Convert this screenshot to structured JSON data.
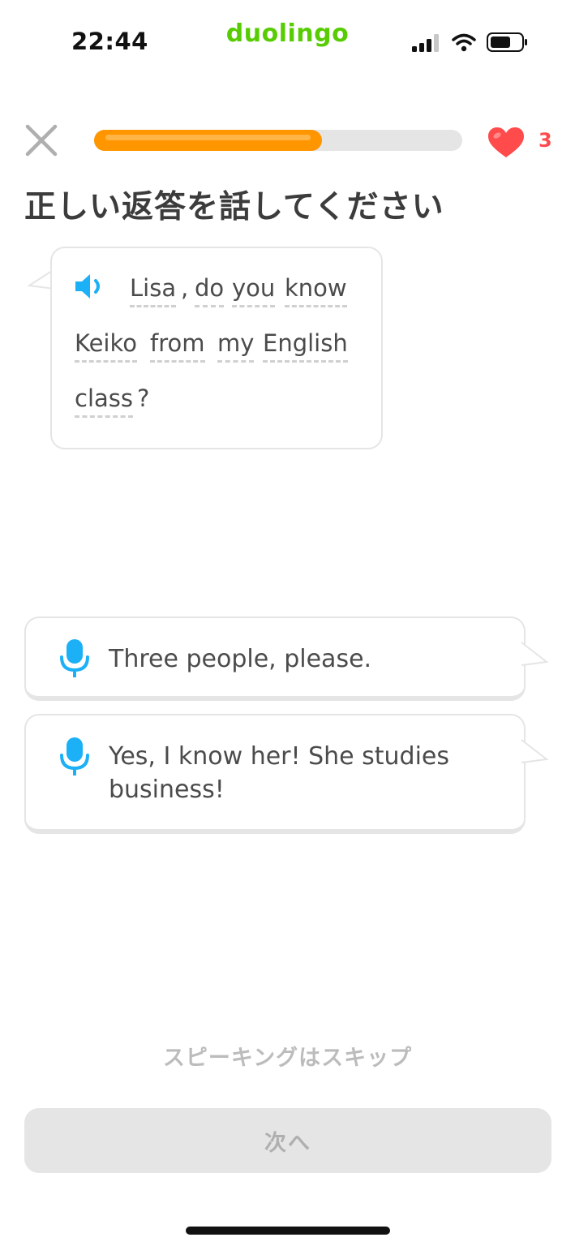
{
  "status_bar": {
    "time": "22:44",
    "brand": "duolingo"
  },
  "lesson": {
    "progress": 0.62,
    "hearts": "3",
    "instruction": "正しい返答を話してください"
  },
  "prompt": {
    "words": [
      "Lisa",
      ",",
      "do",
      "you",
      "know",
      "Keiko",
      "from",
      "my",
      "English",
      "class",
      "?"
    ]
  },
  "options": [
    {
      "lines": [
        "Three people, please."
      ]
    },
    {
      "lines": [
        "Yes, I know her! She studies",
        "business!"
      ]
    }
  ],
  "footer": {
    "skip_label": "スピーキングはスキップ",
    "next_label": "次へ"
  },
  "colors": {
    "brand": "#58cc02",
    "progress": "#ff9600",
    "heart": "#ff4b4b",
    "accent_blue": "#1cb0f6",
    "disabled_gray": "#e5e5e5"
  },
  "icons": [
    "close-icon",
    "heart-icon",
    "speaker-icon",
    "microphone-icon",
    "signal-icon",
    "wifi-icon",
    "battery-icon"
  ]
}
